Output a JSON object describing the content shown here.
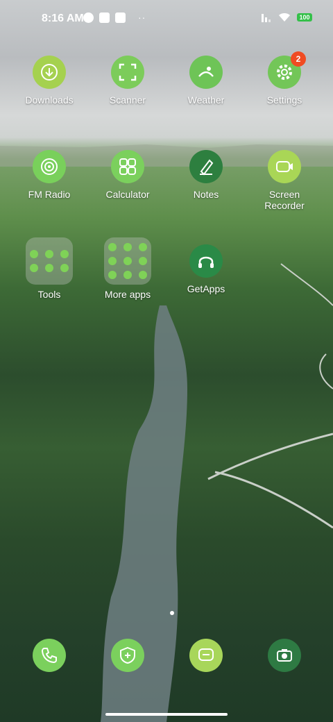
{
  "status_bar": {
    "time": "8:16 AM",
    "battery": "100",
    "dots": "··"
  },
  "apps": [
    {
      "label": "Downloads",
      "icon": "download-icon",
      "color": "#a5d14f",
      "badge": ""
    },
    {
      "label": "Scanner",
      "icon": "scanner-icon",
      "color": "#7ccc5a",
      "badge": ""
    },
    {
      "label": "Weather",
      "icon": "weather-icon",
      "color": "#6ec457",
      "badge": ""
    },
    {
      "label": "Settings",
      "icon": "gear-icon",
      "color": "#73c658",
      "badge": "2"
    },
    {
      "label": "FM Radio",
      "icon": "radio-icon",
      "color": "#79d05b",
      "badge": ""
    },
    {
      "label": "Calculator",
      "icon": "calculator-icon",
      "color": "#7bd05d",
      "badge": ""
    },
    {
      "label": "Notes",
      "icon": "pen-icon",
      "color": "#2d7f3f",
      "badge": ""
    },
    {
      "label": "Screen\nRecorder",
      "icon": "video-icon",
      "color": "#a9d656",
      "badge": ""
    },
    {
      "label": "Tools",
      "icon": "folder-icon",
      "color": "#7fd257",
      "badge": ""
    },
    {
      "label": "More apps",
      "icon": "folder-icon",
      "color": "#7fd257",
      "badge": ""
    },
    {
      "label": "GetApps",
      "icon": "headphones-icon",
      "color": "#2a8a47",
      "badge": ""
    }
  ],
  "dock": [
    {
      "icon": "phone-icon",
      "color": "#7bd05d"
    },
    {
      "icon": "shield-icon",
      "color": "#7bd05d"
    },
    {
      "icon": "message-icon",
      "color": "#a8d65a"
    },
    {
      "icon": "camera-icon",
      "color": "#2e7a43"
    }
  ]
}
